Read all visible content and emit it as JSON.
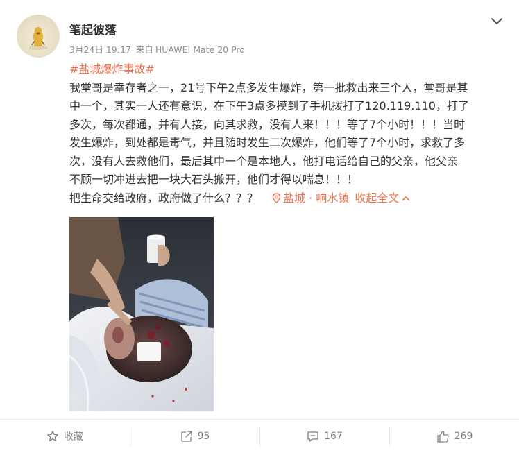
{
  "post": {
    "username": "笔起彼落",
    "time": "3月24日 19:17",
    "source_prefix": "来自",
    "device": "HUAWEI Mate 20 Pro",
    "topic": "#盐城爆炸事故#",
    "lines": [
      "我堂哥是幸存者之一，21号下午2点多发生爆炸，第一批救出来三个人，堂哥是其",
      "中一个，其实一人还有意识，在下午3点多摸到了手机拨打了120.119.110，打了",
      "多次，每次都通，并有人接，向其求救，没有人来！！！等了7个小时！！！当时",
      "发生爆炸，到处都是毒气，并且随时发生二次爆炸，他们等了7个小时，求救了多",
      "次，没有人去救他们，最后其中一个是本地人，他打电话给自己的父亲，他父亲",
      "不顾一切冲进去把一块大石头搬开，他们才得以喘息！！！"
    ],
    "last_line": "把生命交给政府，政府做了什么？？？",
    "location": "盐城 · 响水镇",
    "collapse_label": "收起全文",
    "icons": {
      "more": "chevron-down-icon",
      "location": "location-pin-icon",
      "collapse": "chevron-up-icon"
    }
  },
  "actions": {
    "favorite": {
      "label": "收藏",
      "icon": "star-icon"
    },
    "repost": {
      "count": "95",
      "icon": "repost-icon"
    },
    "comment": {
      "count": "167",
      "icon": "comment-icon"
    },
    "like": {
      "count": "269",
      "icon": "thumbs-up-icon"
    }
  },
  "colors": {
    "accent": "#eb7350",
    "text": "#333333",
    "meta": "#8f8f8f"
  }
}
